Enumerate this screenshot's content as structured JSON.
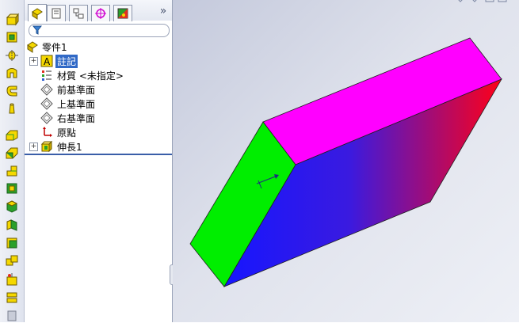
{
  "command_strip": {
    "buttons": [
      "extrude-boss-icon",
      "revolve-boss-icon",
      "sweep-icon",
      "loft-icon",
      "fillet-icon",
      "chamfer-icon",
      "rib-icon",
      "shell-icon",
      "draft-icon",
      "hole-icon",
      "dome-icon",
      "wrap-icon",
      "mirror-icon",
      "scale-icon",
      "intersect-icon",
      "split-icon",
      "combine-icon"
    ]
  },
  "feature_manager": {
    "tabs": [
      "featuremanager-tab",
      "propertymanager-tab",
      "configurationmanager-tab",
      "dimxpert-tab",
      "display-manager-tab"
    ],
    "expand_glyph": "»",
    "tree": {
      "root": "零件1",
      "items": [
        {
          "label": "註記",
          "icon": "annotations-icon",
          "expandable": true,
          "selected": true
        },
        {
          "label": "材質 <未指定>",
          "icon": "material-icon",
          "expandable": false
        },
        {
          "label": "前基準面",
          "icon": "plane-icon",
          "expandable": false
        },
        {
          "label": "上基準面",
          "icon": "plane-icon",
          "expandable": false
        },
        {
          "label": "右基準面",
          "icon": "plane-icon",
          "expandable": false
        },
        {
          "label": "原點",
          "icon": "origin-icon",
          "expandable": false
        },
        {
          "label": "伸長1",
          "icon": "extrude-feature-icon",
          "expandable": true
        }
      ]
    }
  },
  "viewport": {
    "model_faces": {
      "top_color": "#ff00ff",
      "left_color": "#00ee00",
      "front_gradient": [
        "#1a1aff",
        "#ff0020"
      ]
    },
    "background": [
      "#c4c9dc",
      "#eef0f6"
    ]
  }
}
